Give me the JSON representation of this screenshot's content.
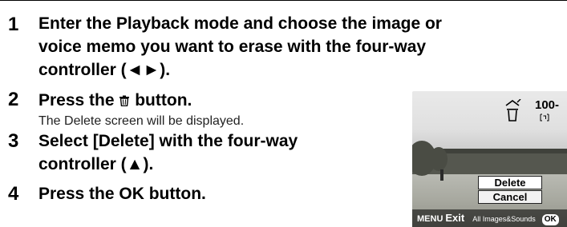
{
  "steps": [
    {
      "number": "1",
      "title_lines": [
        "Enter the Playback mode and choose the image or",
        "voice memo you want to erase with the four-way",
        "controller (◄►)."
      ]
    },
    {
      "number": "2",
      "title_pre": "Press the ",
      "title_post": " button.",
      "description": "The Delete screen will be displayed."
    },
    {
      "number": "3",
      "title_lines": [
        "Select [Delete] with the four-way",
        "controller (▲)."
      ]
    },
    {
      "number": "4",
      "title": "Press the OK button."
    }
  ],
  "camera_screen": {
    "folder_number": "100-",
    "options": [
      "Delete",
      "Cancel"
    ],
    "selected_option": "Delete",
    "bottom_bar": {
      "menu_key": "MENU",
      "exit_label": "Exit",
      "all_label": "All Images&Sounds",
      "ok_key": "OK"
    },
    "icons": [
      "protect-trash-icon",
      "voice-memo-icon"
    ]
  }
}
